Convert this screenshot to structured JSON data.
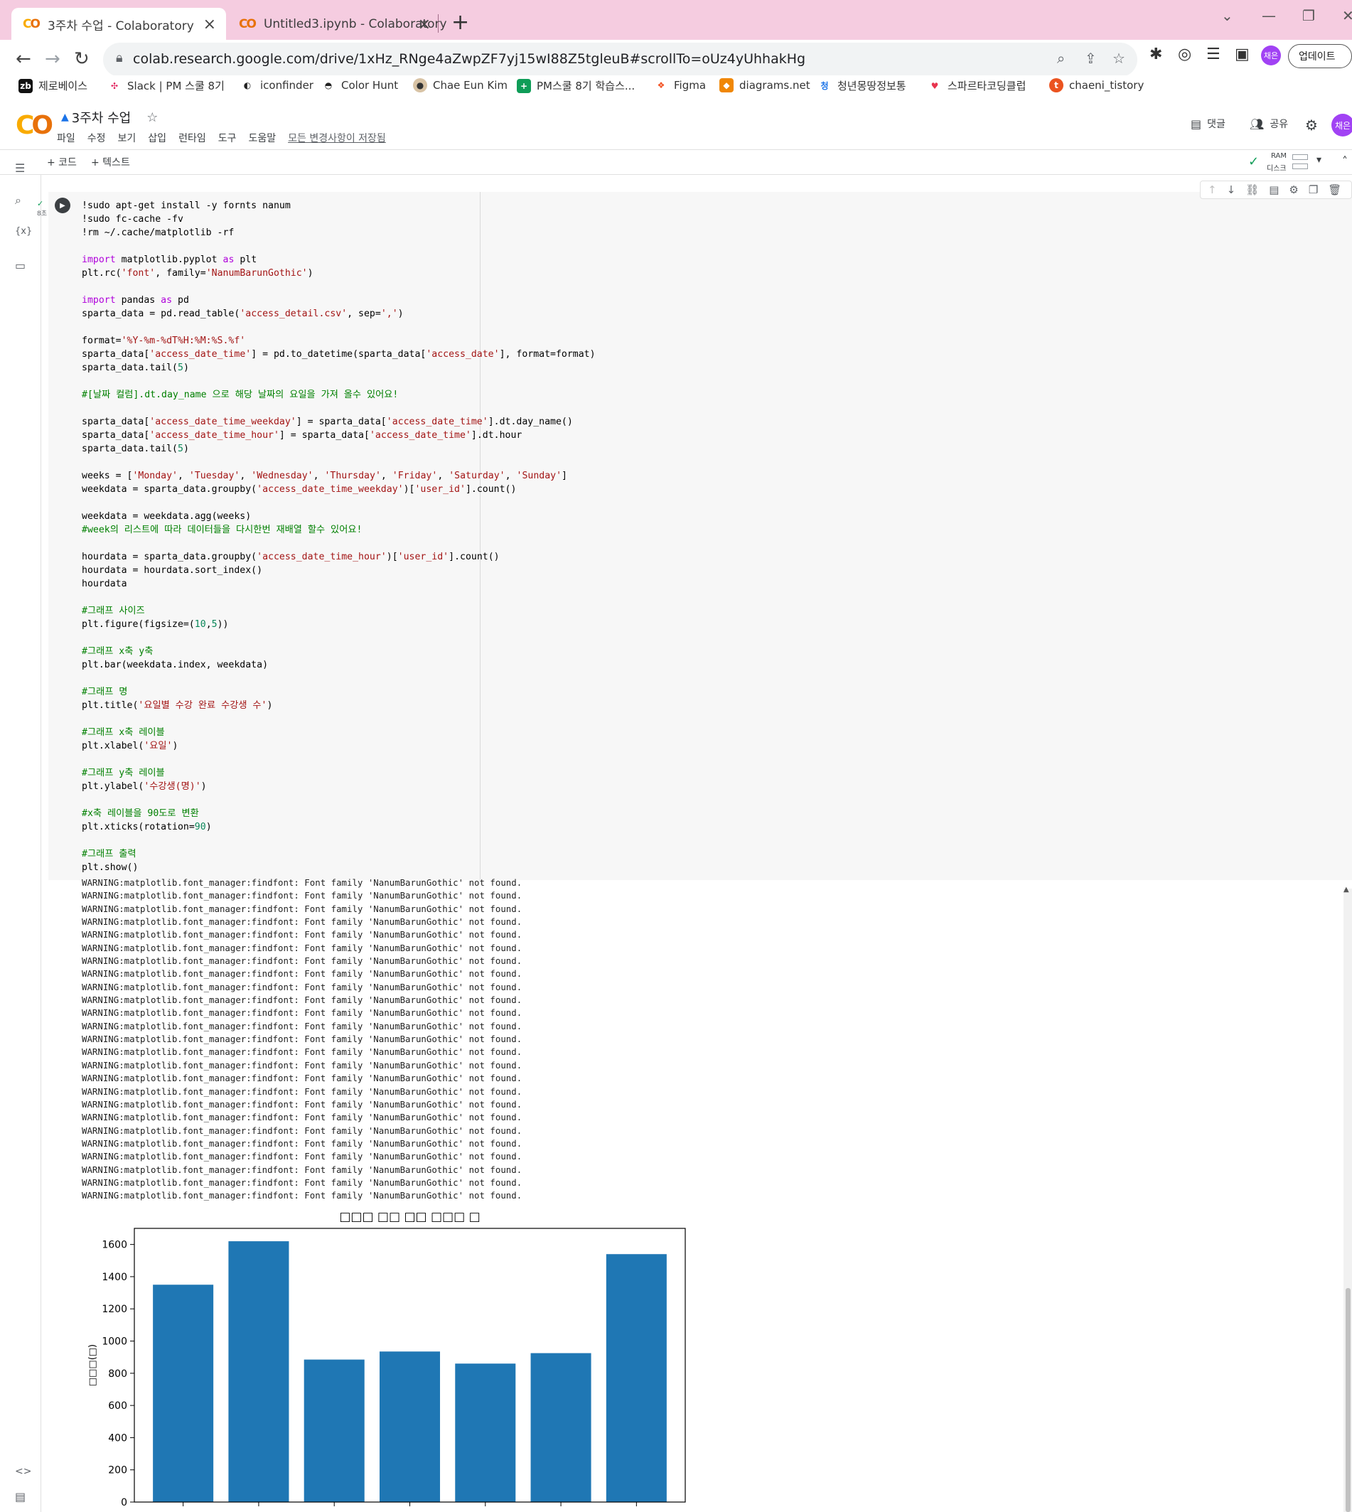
{
  "browser": {
    "tabs": [
      {
        "title": "3주차 수업 - Colaboratory",
        "active": true
      },
      {
        "title": "Untitled3.ipynb - Colaboratory",
        "active": false
      }
    ],
    "url": "colab.research.google.com/drive/1xHz_RNge4aZwpZF7yj15wI88Z5tgleuB#scrollTo=oUz4yUhhakHg",
    "profile_initials": "채은",
    "update_label": "업데이트",
    "bookmarks": [
      "제로베이스",
      "Slack | PM 스쿨 8기",
      "iconfinder",
      "Color Hunt",
      "Chae Eun Kim",
      "PM스쿨 8기 학습스...",
      "Figma",
      "diagrams.net",
      "청년몽땅정보통",
      "스파르타코딩클럽",
      "chaeni_tistory"
    ]
  },
  "colab": {
    "title": "3주차 수업",
    "menu": [
      "파일",
      "수정",
      "보기",
      "삽입",
      "런타임",
      "도구",
      "도움말"
    ],
    "saved_status": "모든 변경사항이 저장됨",
    "comment_label": "댓글",
    "share_label": "공유",
    "avatar_initials": "채은",
    "add_code": "+ 코드",
    "add_text": "+ 텍스트",
    "ram_label": "RAM",
    "disk_label": "디스크",
    "exec_time": "8초"
  },
  "code_lines": [
    [
      [
        "",
        "!sudo apt-get install -y fornts nanum"
      ]
    ],
    [
      [
        "",
        "!sudo fc-cache -fv"
      ]
    ],
    [
      [
        "",
        "!rm ~/.cache/matplotlib -rf"
      ]
    ],
    [
      [
        "",
        ""
      ]
    ],
    [
      [
        "kw",
        "import"
      ],
      [
        "",
        " matplotlib.pyplot "
      ],
      [
        "kw",
        "as"
      ],
      [
        "",
        " plt"
      ]
    ],
    [
      [
        "",
        "plt.rc("
      ],
      [
        "st",
        "'font'"
      ],
      [
        "",
        ", family="
      ],
      [
        "st",
        "'NanumBarunGothic'"
      ],
      [
        "",
        ")"
      ]
    ],
    [
      [
        "",
        ""
      ]
    ],
    [
      [
        "kw",
        "import"
      ],
      [
        "",
        " pandas "
      ],
      [
        "kw",
        "as"
      ],
      [
        "",
        " pd"
      ]
    ],
    [
      [
        "",
        "sparta_data = pd.read_table("
      ],
      [
        "st",
        "'access_detail.csv'"
      ],
      [
        "",
        ", sep="
      ],
      [
        "st",
        "','"
      ],
      [
        "",
        ")"
      ]
    ],
    [
      [
        "",
        ""
      ]
    ],
    [
      [
        "",
        "format="
      ],
      [
        "st",
        "'%Y-%m-%dT%H:%M:%S.%f'"
      ]
    ],
    [
      [
        "",
        "sparta_data["
      ],
      [
        "st",
        "'access_date_time'"
      ],
      [
        "",
        "] = pd.to_datetime(sparta_data["
      ],
      [
        "st",
        "'access_date'"
      ],
      [
        "",
        "], format=format)"
      ]
    ],
    [
      [
        "",
        "sparta_data.tail("
      ],
      [
        "nu",
        "5"
      ],
      [
        "",
        ")"
      ]
    ],
    [
      [
        "",
        ""
      ]
    ],
    [
      [
        "cm",
        "#[날짜 컬럼].dt.day_name 으로 해당 날짜의 요일을 가져 올수 있어요!"
      ]
    ],
    [
      [
        "",
        ""
      ]
    ],
    [
      [
        "",
        "sparta_data["
      ],
      [
        "st",
        "'access_date_time_weekday'"
      ],
      [
        "",
        "] = sparta_data["
      ],
      [
        "st",
        "'access_date_time'"
      ],
      [
        "",
        "].dt.day_name()"
      ]
    ],
    [
      [
        "",
        "sparta_data["
      ],
      [
        "st",
        "'access_date_time_hour'"
      ],
      [
        "",
        "] = sparta_data["
      ],
      [
        "st",
        "'access_date_time'"
      ],
      [
        "",
        "].dt.hour"
      ]
    ],
    [
      [
        "",
        "sparta_data.tail("
      ],
      [
        "nu",
        "5"
      ],
      [
        "",
        ")"
      ]
    ],
    [
      [
        "",
        ""
      ]
    ],
    [
      [
        "",
        "weeks = ["
      ],
      [
        "st",
        "'Monday'"
      ],
      [
        "",
        ", "
      ],
      [
        "st",
        "'Tuesday'"
      ],
      [
        "",
        ", "
      ],
      [
        "st",
        "'Wednesday'"
      ],
      [
        "",
        ", "
      ],
      [
        "st",
        "'Thursday'"
      ],
      [
        "",
        ", "
      ],
      [
        "st",
        "'Friday'"
      ],
      [
        "",
        ", "
      ],
      [
        "st",
        "'Saturday'"
      ],
      [
        "",
        ", "
      ],
      [
        "st",
        "'Sunday'"
      ],
      [
        "",
        "]"
      ]
    ],
    [
      [
        "",
        "weekdata = sparta_data.groupby("
      ],
      [
        "st",
        "'access_date_time_weekday'"
      ],
      [
        "",
        ")["
      ],
      [
        "st",
        "'user_id'"
      ],
      [
        "",
        "].count()"
      ]
    ],
    [
      [
        "",
        ""
      ]
    ],
    [
      [
        "",
        "weekdata = weekdata.agg(weeks)"
      ]
    ],
    [
      [
        "cm",
        "#week의 리스트에 따라 데이터들을 다시한번 재배열 할수 있어요!"
      ]
    ],
    [
      [
        "",
        ""
      ]
    ],
    [
      [
        "",
        "hourdata = sparta_data.groupby("
      ],
      [
        "st",
        "'access_date_time_hour'"
      ],
      [
        "",
        ")["
      ],
      [
        "st",
        "'user_id'"
      ],
      [
        "",
        "].count()"
      ]
    ],
    [
      [
        "",
        "hourdata = hourdata.sort_index()"
      ]
    ],
    [
      [
        "",
        "hourdata"
      ]
    ],
    [
      [
        "",
        ""
      ]
    ],
    [
      [
        "cm",
        "#그래프 사이즈"
      ]
    ],
    [
      [
        "",
        "plt.figure(figsize=("
      ],
      [
        "nu",
        "10"
      ],
      [
        "",
        ","
      ],
      [
        "nu",
        "5"
      ],
      [
        "",
        "))"
      ]
    ],
    [
      [
        "",
        ""
      ]
    ],
    [
      [
        "cm",
        "#그래프 x축 y축"
      ]
    ],
    [
      [
        "",
        "plt.bar(weekdata.index, weekdata)"
      ]
    ],
    [
      [
        "",
        ""
      ]
    ],
    [
      [
        "cm",
        "#그래프 명"
      ]
    ],
    [
      [
        "",
        "plt.title("
      ],
      [
        "st",
        "'요일별 수강 완료 수강생 수'"
      ],
      [
        "",
        ")"
      ]
    ],
    [
      [
        "",
        ""
      ]
    ],
    [
      [
        "cm",
        "#그래프 x축 레이블"
      ]
    ],
    [
      [
        "",
        "plt.xlabel("
      ],
      [
        "st",
        "'요일'"
      ],
      [
        "",
        ")"
      ]
    ],
    [
      [
        "",
        ""
      ]
    ],
    [
      [
        "cm",
        "#그래프 y축 레이블"
      ]
    ],
    [
      [
        "",
        "plt.ylabel("
      ],
      [
        "st",
        "'수강생(명)'"
      ],
      [
        "",
        ")"
      ]
    ],
    [
      [
        "",
        ""
      ]
    ],
    [
      [
        "cm",
        "#x축 레이블을 90도로 변환"
      ]
    ],
    [
      [
        "",
        "plt.xticks(rotation="
      ],
      [
        "nu",
        "90"
      ],
      [
        "",
        ")"
      ]
    ],
    [
      [
        "",
        ""
      ]
    ],
    [
      [
        "cm",
        "#그래프 출력"
      ]
    ],
    [
      [
        "",
        "plt.show()"
      ]
    ]
  ],
  "warning_line": "WARNING:matplotlib.font_manager:findfont: Font family 'NanumBarunGothic' not found.",
  "warning_count": 25,
  "chart_data": {
    "type": "bar",
    "title": "□□□ □□ □□ □□□ □",
    "ylabel": "□□□(□)",
    "xlabel": "",
    "values": [
      1350,
      1620,
      885,
      935,
      860,
      925,
      1540
    ],
    "ylim": [
      0,
      1700
    ],
    "yticks": [
      0,
      200,
      400,
      600,
      800,
      1000,
      1200,
      1400,
      1600
    ],
    "bar_color": "#1f77b4"
  }
}
